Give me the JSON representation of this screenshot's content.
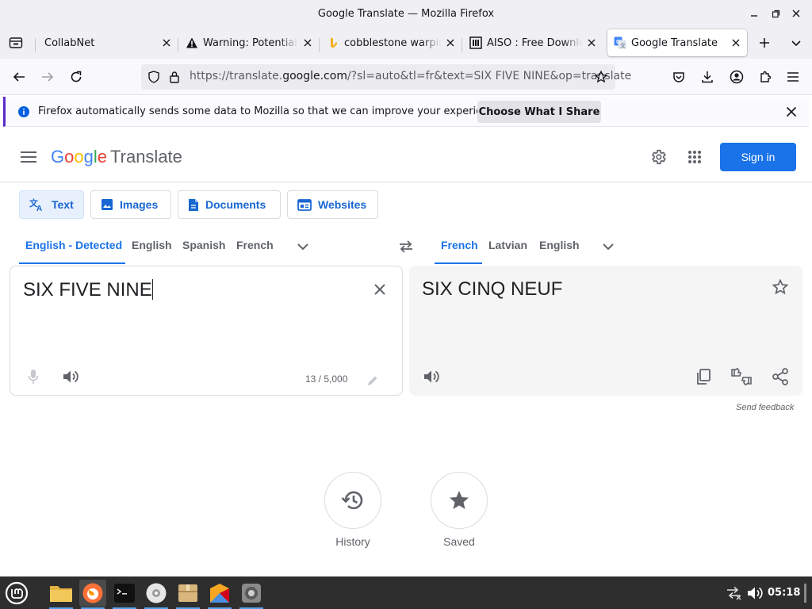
{
  "window": {
    "title": "Google Translate — Mozilla Firefox"
  },
  "tabs": [
    {
      "label": "CollabNet",
      "favicon": "collabnet-icon",
      "active": false
    },
    {
      "label": "Warning: Potential Security Risk Ahead",
      "favicon": "warning-icon",
      "active": false
    },
    {
      "label": "cobblestone warping",
      "favicon": "bing-icon",
      "active": false
    },
    {
      "label": "AISO : Free Download",
      "favicon": "aiso-icon",
      "active": false
    },
    {
      "label": "Google Translate",
      "favicon": "google-translate-icon",
      "active": true
    }
  ],
  "navbar": {
    "url_prefix": "https://translate.",
    "url_domain": "google.com",
    "url_suffix": "/?sl=auto&tl=fr&text=SIX FIVE NINE&op=translate"
  },
  "notification": {
    "text": "Firefox automatically sends some data to Mozilla so that we can improve your experience.",
    "button": "Choose What I Share"
  },
  "translate": {
    "logo_letters": [
      "G",
      "o",
      "o",
      "g",
      "l",
      "e"
    ],
    "product": "Translate",
    "sign_in": "Sign in",
    "modes": [
      "Text",
      "Images",
      "Documents",
      "Websites"
    ],
    "active_mode": "Text",
    "source_langs": [
      "English - Detected",
      "English",
      "Spanish",
      "French"
    ],
    "target_langs": [
      "French",
      "Latvian",
      "English"
    ],
    "source_text": "SIX FIVE NINE",
    "char_count": "13 / 5,000",
    "translated_text": "SIX CINQ NEUF",
    "send_feedback": "Send feedback",
    "history_label": "History",
    "saved_label": "Saved"
  },
  "taskbar": {
    "clock": "05:18",
    "apps": [
      "files-icon",
      "firefox-icon",
      "terminal-icon",
      "disc-icon",
      "archive-icon",
      "files-alt-icon",
      "screenshot-icon"
    ]
  },
  "colors": {
    "accent": "#1a73e8",
    "taskbar": "#2e2e2e",
    "notification_accent": "#592acb"
  }
}
